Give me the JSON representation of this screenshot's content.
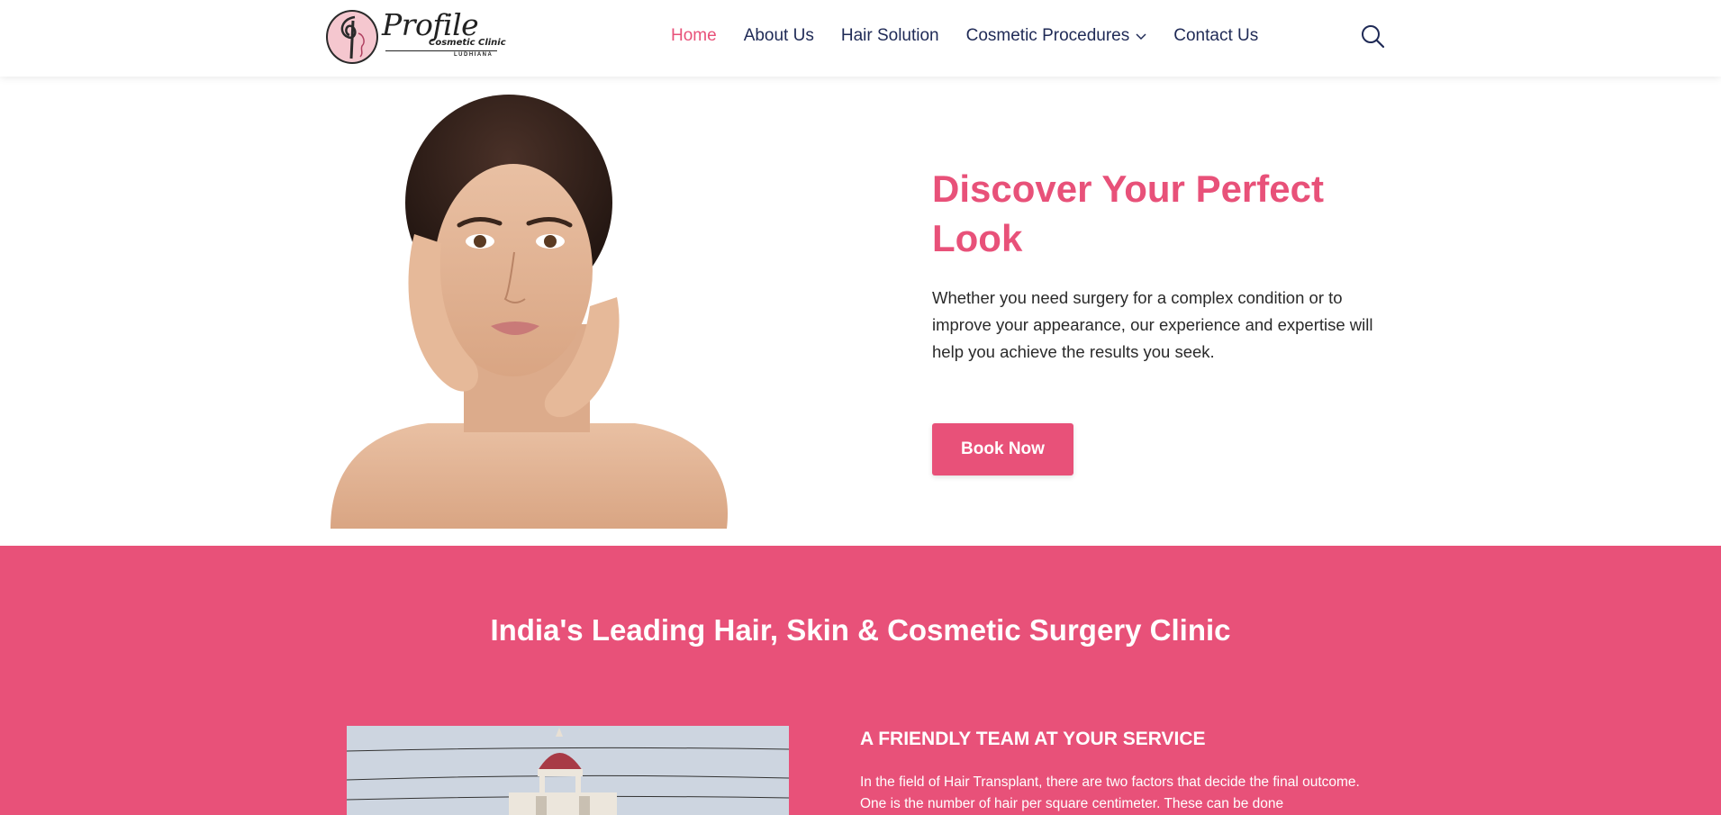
{
  "header": {
    "logo": {
      "title": "Profile",
      "subtitle": "Cosmetic Clinic",
      "city": "LUDHIANA"
    },
    "nav": [
      {
        "label": "Home",
        "active": true
      },
      {
        "label": "About Us",
        "active": false
      },
      {
        "label": "Hair Solution",
        "active": false
      },
      {
        "label": "Cosmetic Procedures",
        "active": false,
        "has_dropdown": true
      },
      {
        "label": "Contact Us",
        "active": false
      }
    ],
    "search_icon": "search-icon"
  },
  "hero": {
    "title": "Discover Your Perfect Look",
    "description": "Whether you need surgery for a complex condition or to improve your appearance, our experience and expertise will help you achieve the results you seek.",
    "button_label": "Book Now",
    "image": "woman-portrait"
  },
  "section": {
    "title": "India's Leading Hair, Skin & Cosmetic Surgery Clinic",
    "team_heading": "A FRIENDLY TEAM AT YOUR SERVICE",
    "team_text": "In the field of Hair Transplant, there are two factors that decide the final outcome. One is the number of hair per square centimeter. These can be done",
    "image": "clinic-building"
  },
  "colors": {
    "accent": "#e85179",
    "nav_text": "#1f2a56",
    "body_text": "#2a2a2a",
    "background": "#ffffff"
  }
}
